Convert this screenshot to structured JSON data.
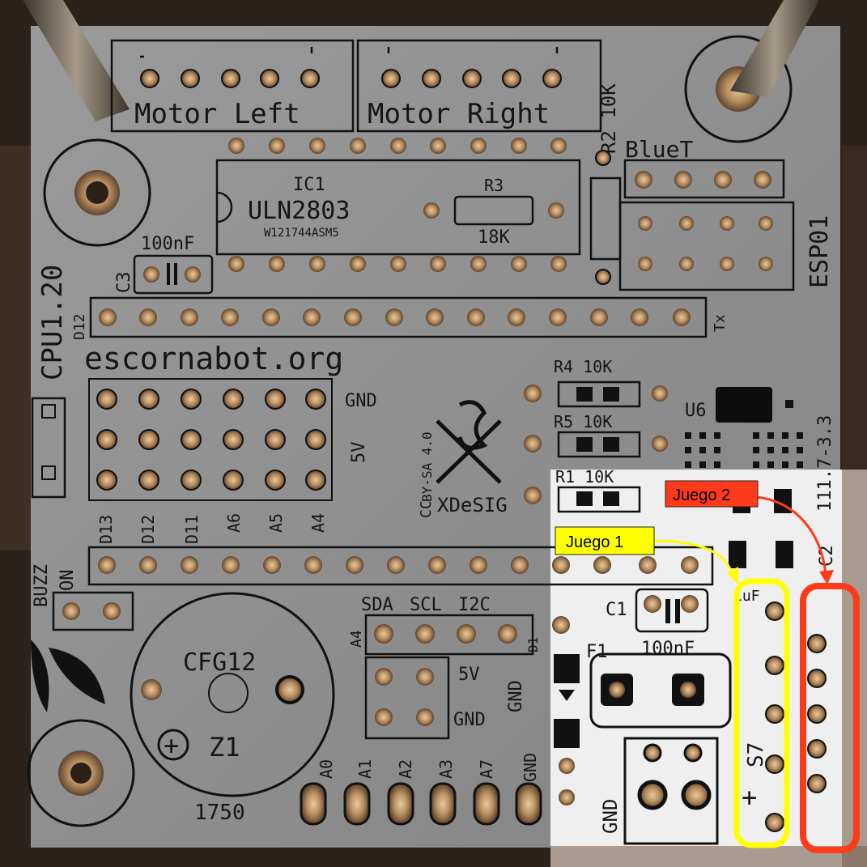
{
  "board": {
    "motor_left": "Motor Left",
    "motor_right": "Motor Right",
    "r2": "R2 10K",
    "bluet": "BlueT",
    "esp01": "ESP01",
    "ic1": "IC1",
    "uln": "ULN2803",
    "ic_code": "W121744ASM5",
    "r3": "R3",
    "r3_val": "18K",
    "c3_val": "100nF",
    "c3": "C3",
    "cpu": "CPU1.20",
    "d12_top": "D12",
    "tx": "Tx",
    "site": "escornabot.org",
    "gnd": "GND",
    "v5": "5V",
    "cc": "CC",
    "by_sa": "BY-SA 4.0",
    "xdesig": "XDeSIG",
    "r4": "R4 10K",
    "r5": "R5 10K",
    "r1": "R1 10K",
    "u6": "U6",
    "ver": "111.7-3.3",
    "pins": [
      "D13",
      "D12",
      "D11",
      "A6",
      "A5",
      "A4"
    ],
    "buzz": "BUZZ",
    "on": "ON",
    "cfg": "CFG12",
    "z1": "Z1",
    "plus": "+",
    "n1750": "1750",
    "sda": "SDA",
    "scl": "SCL",
    "i2c": "I2C",
    "a4": "A4",
    "v5b": "5V",
    "gnd_b": "GND",
    "gnd_c": "GND",
    "d1": "D1",
    "bottom_pins": [
      "A0",
      "A1",
      "A2",
      "A3",
      "A7",
      "GND"
    ],
    "c1": "C1",
    "c1_val": "100nF",
    "f1": "F1",
    "uf": "1uF",
    "c2": "C2",
    "s7": "S7",
    "gnd_d": "GND"
  },
  "annotations": {
    "juego1": "Juego 1",
    "juego2": "Juego 2",
    "juego1_color": "#ffff00",
    "juego2_color": "#ff3a1a"
  }
}
